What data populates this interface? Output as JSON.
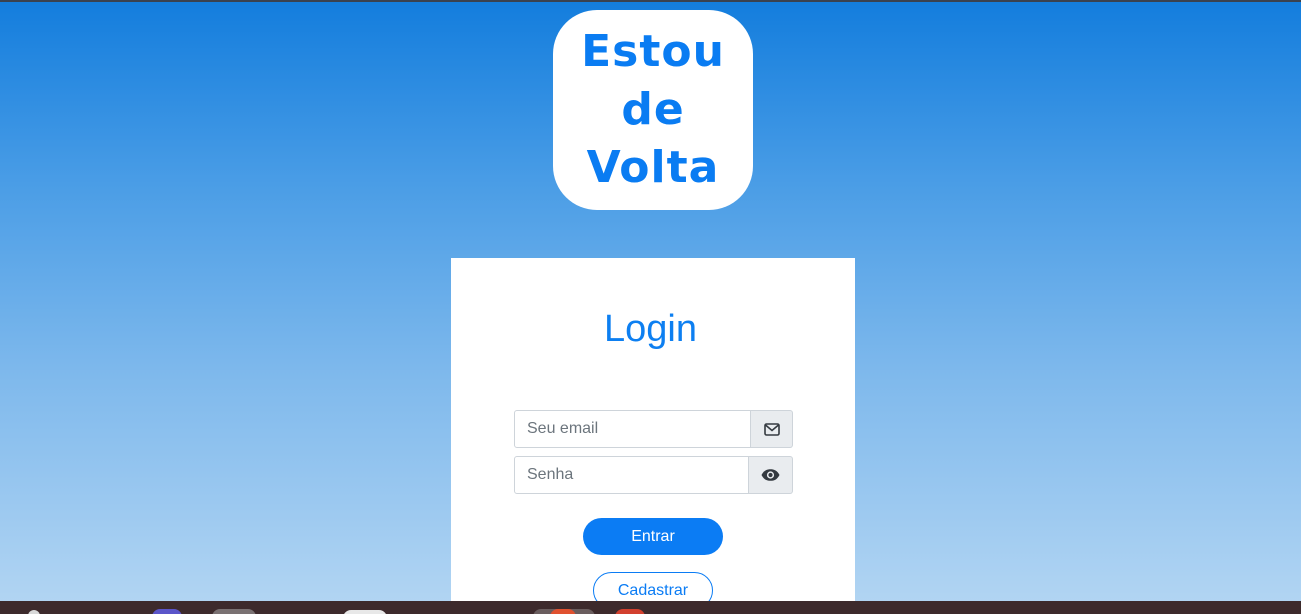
{
  "logo": {
    "line1": "Estou",
    "line2": "de",
    "line3": "Volta"
  },
  "login": {
    "title": "Login",
    "email_placeholder": "Seu email",
    "password_placeholder": "Senha",
    "submit_label": "Entrar",
    "register_label": "Cadastrar"
  },
  "icons": {
    "email_addon": "envelope-icon",
    "password_addon": "eye-icon"
  },
  "colors": {
    "accent": "#0b7cf4",
    "background_top": "#137ddd",
    "background_bottom": "#b4d6f3",
    "addon_bg": "#e9ecef"
  }
}
